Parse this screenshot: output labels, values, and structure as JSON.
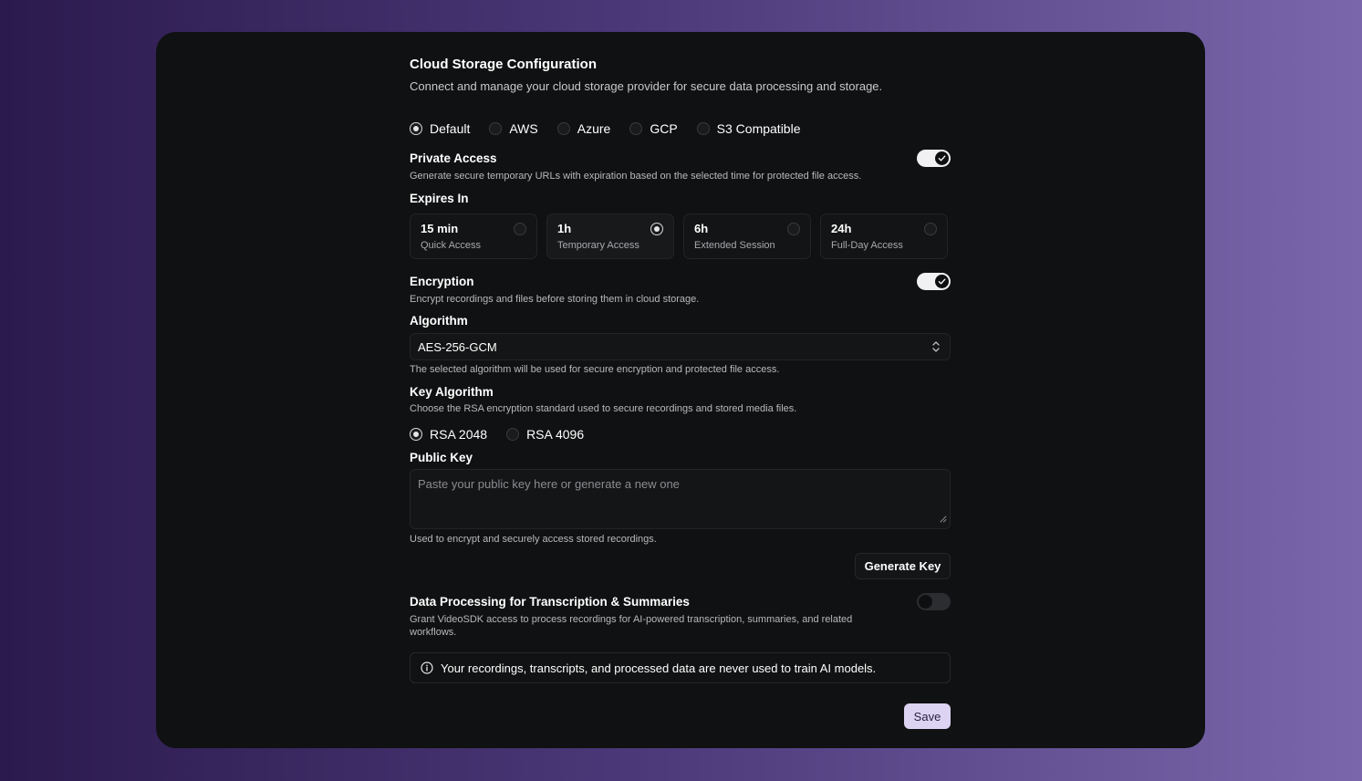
{
  "header": {
    "title": "Cloud Storage Configuration",
    "subtitle": "Connect and manage your cloud storage provider for secure data processing and storage."
  },
  "providers": [
    {
      "label": "Default",
      "selected": true
    },
    {
      "label": "AWS",
      "selected": false
    },
    {
      "label": "Azure",
      "selected": false
    },
    {
      "label": "GCP",
      "selected": false
    },
    {
      "label": "S3 Compatible",
      "selected": false
    }
  ],
  "private_access": {
    "label": "Private Access",
    "description": "Generate secure temporary URLs with expiration based on the selected time for protected file access.",
    "enabled": true
  },
  "expires": {
    "label": "Expires In",
    "options": [
      {
        "title": "15 min",
        "subtitle": "Quick Access",
        "selected": false
      },
      {
        "title": "1h",
        "subtitle": "Temporary Access",
        "selected": true
      },
      {
        "title": "6h",
        "subtitle": "Extended Session",
        "selected": false
      },
      {
        "title": "24h",
        "subtitle": "Full-Day Access",
        "selected": false
      }
    ]
  },
  "encryption": {
    "label": "Encryption",
    "description": "Encrypt recordings and files before storing them in cloud storage.",
    "enabled": true
  },
  "algorithm": {
    "label": "Algorithm",
    "value": "AES-256-GCM",
    "help": "The selected algorithm will be used for secure encryption and protected file access."
  },
  "key_algorithm": {
    "label": "Key Algorithm",
    "description": "Choose the RSA encryption standard used to secure recordings and stored media files.",
    "options": [
      {
        "label": "RSA 2048",
        "selected": true
      },
      {
        "label": "RSA 4096",
        "selected": false
      }
    ]
  },
  "public_key": {
    "label": "Public Key",
    "placeholder": "Paste your public key here or generate a new one",
    "help": "Used to encrypt and securely access stored recordings.",
    "generate_label": "Generate Key"
  },
  "data_processing": {
    "label": "Data Processing for Transcription & Summaries",
    "description_line1": "Grant VideoSDK access to process recordings for AI-powered transcription, summaries, and related",
    "description_line2": "workflows.",
    "enabled": false
  },
  "notice": {
    "text": "Your recordings, transcripts, and processed data are never used to train AI models.",
    "icon": "info-icon"
  },
  "footer": {
    "save_label": "Save",
    "save_color": "#dcd2f2"
  }
}
